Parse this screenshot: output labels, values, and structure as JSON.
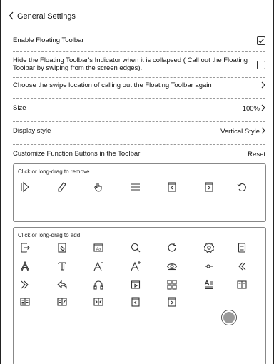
{
  "header": {
    "back_icon": "chevron-left-icon",
    "title": "General Settings"
  },
  "settings": {
    "enable_floating_toolbar": {
      "label": "Enable Floating Toolbar",
      "checked": true
    },
    "hide_indicator": {
      "label": "Hide the Floating Toolbar's Indicator when it is collapsed ( Call out the Floating Toolbar by swiping from the screen edges).",
      "checked": false
    },
    "swipe_location": {
      "label": "Choose the swipe location of calling out the Floating Toolbar again"
    },
    "size": {
      "label": "Size",
      "value": "100%"
    },
    "display_style": {
      "label": "Display style",
      "value": "Vertical Style"
    },
    "customize": {
      "label": "Customize Function Buttons in the Toolbar",
      "reset_label": "Reset"
    }
  },
  "remove_panel": {
    "title": "Click or long-drag to remove",
    "icons": [
      "collapse-toolbar-icon",
      "pen-icon",
      "hand-touch-icon",
      "menu-icon",
      "page-up-icon",
      "page-down-icon",
      "undo-icon"
    ]
  },
  "add_panel": {
    "title": "Click or long-drag to add",
    "icons": [
      "exit-icon",
      "eraser-icon",
      "font-box-icon",
      "search-icon",
      "refresh-icon",
      "settings-gear-icon",
      "document-icon",
      "font-outline-icon",
      "font-serif-icon",
      "font-decrease-icon",
      "font-increase-icon",
      "eye-icon",
      "slider-icon",
      "double-chevron-left-icon",
      "double-chevron-right-icon",
      "back-arrow-icon",
      "headphones-icon",
      "play-box-icon",
      "grid-icon",
      "text-align-icon",
      "dual-page-icon",
      "book-open-icon",
      "book-dual-icon",
      "split-view-icon",
      "page-up-icon",
      "page-down-icon"
    ]
  },
  "floating_ball": {
    "icon": "floating-ball-icon"
  }
}
